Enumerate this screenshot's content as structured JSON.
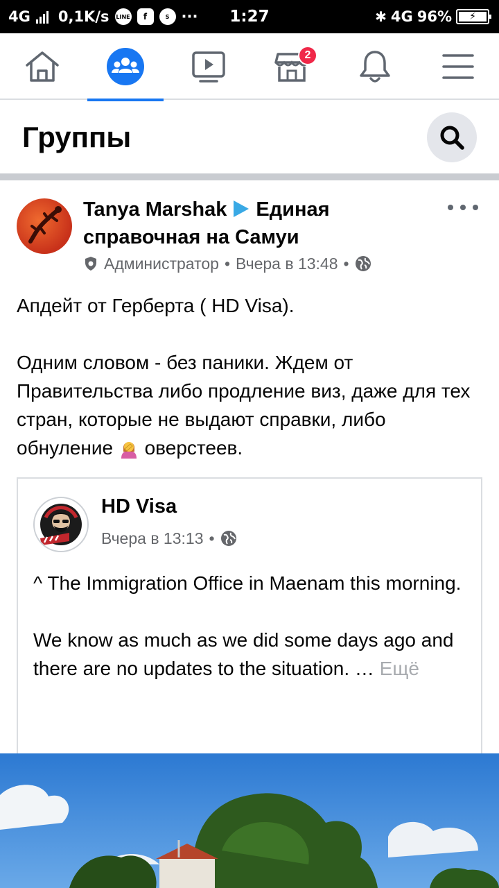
{
  "status_bar": {
    "network": "4G",
    "speed": "0,1K/s",
    "more": "···",
    "time": "1:27",
    "network_right": "4G",
    "battery": "96%"
  },
  "nav": {
    "tabs": [
      {
        "name": "home",
        "icon": "home-icon"
      },
      {
        "name": "groups",
        "icon": "groups-icon",
        "active": true
      },
      {
        "name": "watch",
        "icon": "video-icon"
      },
      {
        "name": "marketplace",
        "icon": "marketplace-icon",
        "badge": "2"
      },
      {
        "name": "notifications",
        "icon": "bell-icon"
      },
      {
        "name": "menu",
        "icon": "menu-icon"
      }
    ]
  },
  "header": {
    "title": "Группы"
  },
  "post": {
    "author": "Tanya Marshak",
    "group": "Единая справочная на Самуи",
    "role": "Администратор",
    "sep": "•",
    "time": "Вчера в 13:48",
    "text_1": "Апдейт от Герберта ( HD Visa).",
    "text_2a": "Одним словом - без паники. Ждем от Правительства либо продление виз, даже для тех стран, которые не выдают справки, либо обнуление",
    "text_2b": "оверстеев."
  },
  "shared": {
    "author": "HD Visa",
    "time": "Вчера в 13:13",
    "sep": "•",
    "text_1": "^ The Immigration Office in Maenam this morning.",
    "text_2": "We know as much as we did some days ago and there are no updates to the situation. …",
    "see_more": "Ещё"
  },
  "colors": {
    "accent": "#1877f2",
    "badge": "#f02849",
    "arrow": "#39a9e5"
  }
}
